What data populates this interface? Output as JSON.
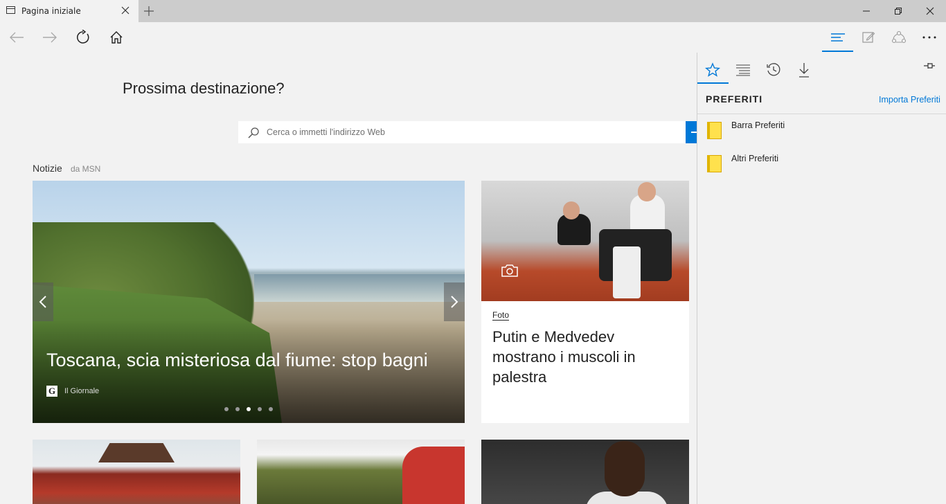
{
  "tab": {
    "title": "Pagina iniziale"
  },
  "page": {
    "headline": "Prossima destinazione?",
    "search_placeholder": "Cerca o immetti l'indirizzo Web"
  },
  "news": {
    "label": "Notizie",
    "source": "da MSN",
    "hero": {
      "title": "Toscana, scia misteriosa dal fiume: stop bagni",
      "source_logo": "G",
      "source": "Il Giornale",
      "carousel_index": 3,
      "carousel_count": 5
    },
    "card": {
      "category": "Foto",
      "title": "Putin e Medvedev mostrano i muscoli in palestra"
    }
  },
  "hub": {
    "heading": "PREFERITI",
    "import_link": "Importa Preferiti",
    "items": [
      {
        "label": "Barra Preferiti"
      },
      {
        "label": "Altri Preferiti"
      }
    ]
  },
  "colors": {
    "accent": "#0078d7",
    "folder": "#ffe14d"
  }
}
